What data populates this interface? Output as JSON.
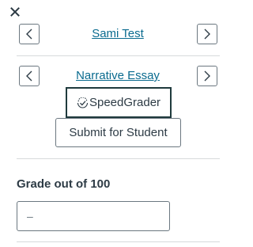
{
  "nav": {
    "student_name": "Sami Test",
    "assignment_name": "Narrative Essay"
  },
  "actions": {
    "speedgrader_label": "SpeedGrader",
    "submit_label": "Submit for Student"
  },
  "grade": {
    "label": "Grade out of 100",
    "value": "",
    "placeholder": "–"
  },
  "icons": {
    "close": "close-icon",
    "previous": "chevron-left-icon",
    "next": "chevron-right-icon",
    "speedgrader": "speedgrader-icon"
  },
  "colors": {
    "link": "#0a6b8f",
    "text": "#2d3b45",
    "focus_border": "#1f3a3d",
    "border": "#6b7780",
    "divider": "#d7dadc"
  }
}
